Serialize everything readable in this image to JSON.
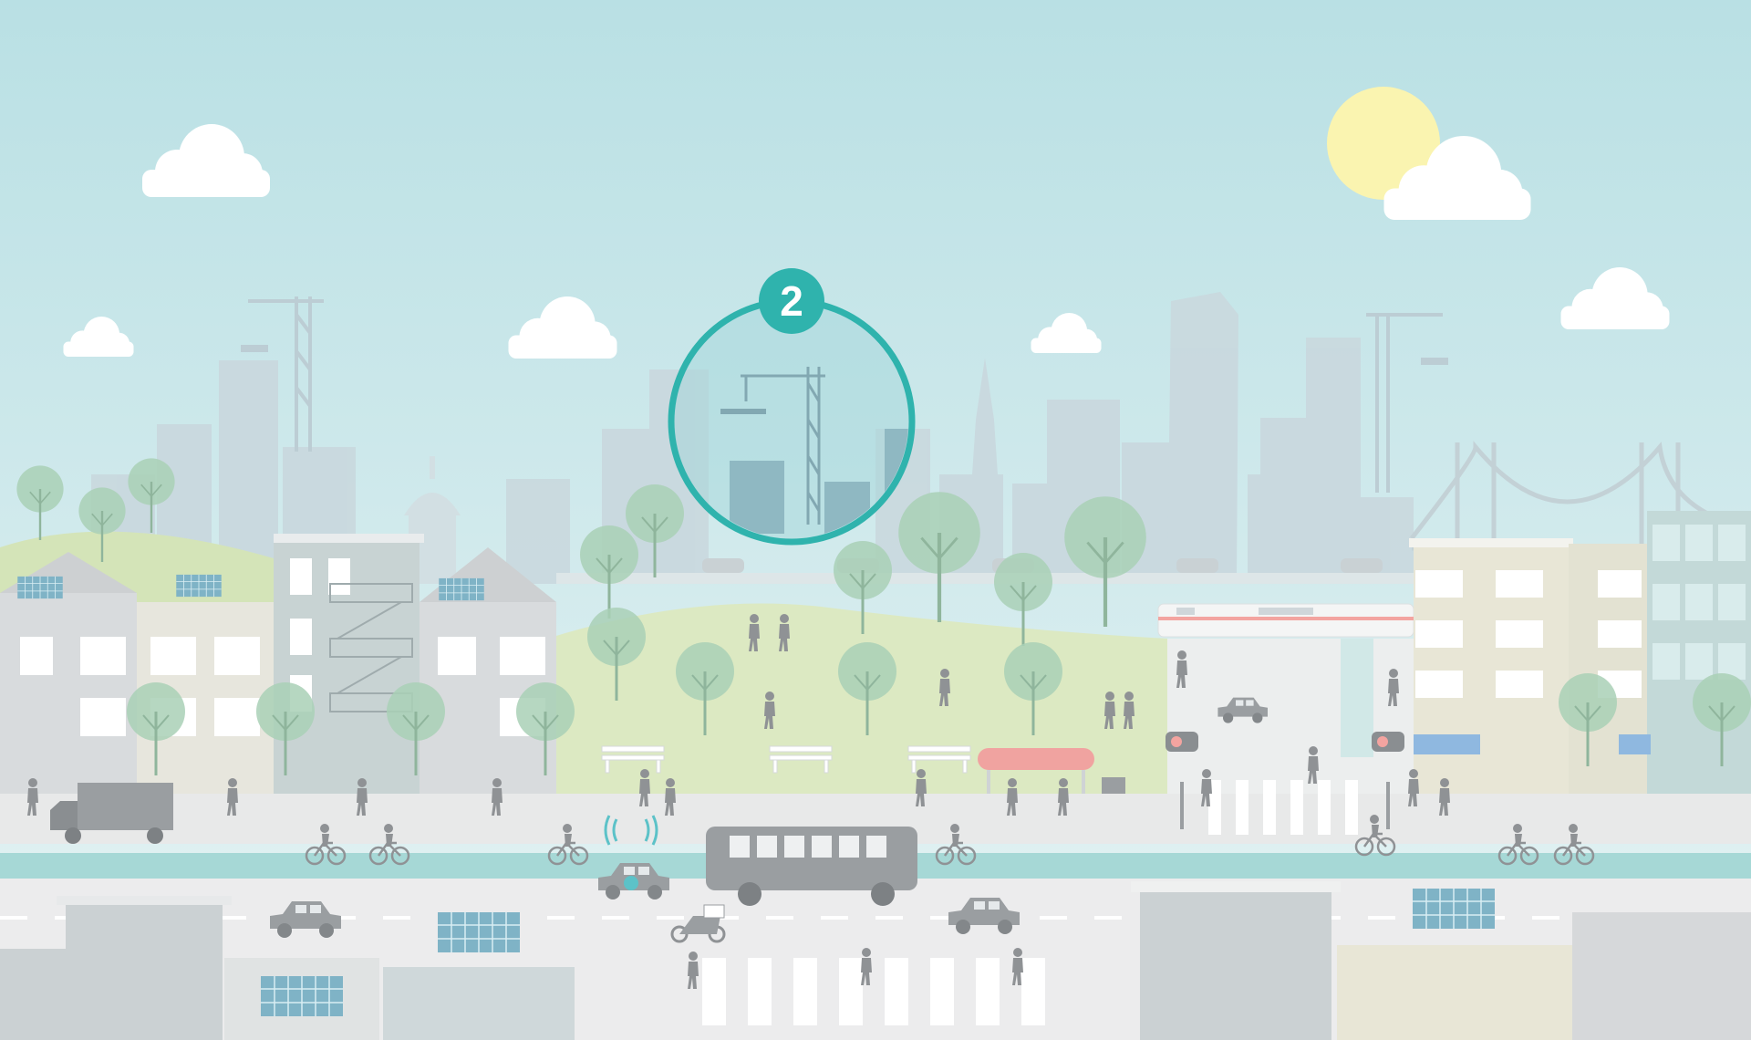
{
  "scene": {
    "highlight_step": "2",
    "highlight_subject": "construction-crane",
    "colors": {
      "sky_top": "#b9e0e4",
      "sky_bottom": "#e4f2f3",
      "accent_teal": "#2fb3ad",
      "sun": "#faf4b0",
      "cloud": "#ffffff",
      "skyline": "#c9d8de",
      "park_grass": "#dbe8c0",
      "tree": "#a8cfb4",
      "road": "#e9ebec",
      "bike_lane": "#a6d8d6",
      "figure": "#8f9295",
      "bus_stop_roof": "#f0a3a0",
      "solar_panel": "#7fb3c6"
    },
    "icons": [
      "cloud-icon",
      "sun-icon",
      "crane-icon",
      "bridge-icon",
      "train-icon",
      "bus-icon",
      "car-icon",
      "truck-icon",
      "bicycle-icon",
      "autonomous-car-icon",
      "scooter-icon",
      "pedestrian-icon",
      "tree-icon",
      "bench-icon",
      "bus-stop-icon",
      "traffic-signal-icon",
      "solar-panel-icon"
    ]
  }
}
